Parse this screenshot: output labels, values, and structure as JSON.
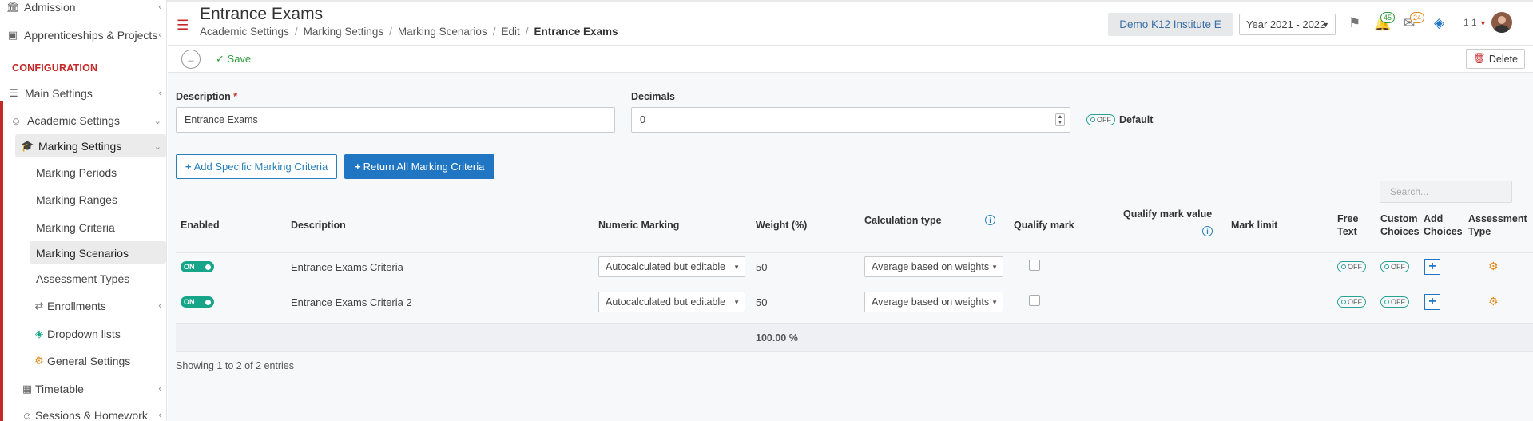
{
  "sidebar": {
    "items": [
      {
        "label": "Admission",
        "icon": "institution-icon"
      },
      {
        "label": "Apprenticeships & Projects",
        "icon": "cube-icon"
      },
      {
        "label": "Main Settings",
        "icon": "sliders-icon"
      },
      {
        "label": "Academic Settings",
        "icon": "users-icon"
      },
      {
        "label": "Marking Settings",
        "icon": "graduation-cap-icon"
      },
      {
        "label": "Marking Periods"
      },
      {
        "label": "Marking Ranges"
      },
      {
        "label": "Marking Criteria"
      },
      {
        "label": "Marking Scenarios"
      },
      {
        "label": "Assessment Types"
      },
      {
        "label": "Enrollments",
        "icon": "exchange-icon"
      },
      {
        "label": "Dropdown lists",
        "icon": "layers-icon"
      },
      {
        "label": "General Settings",
        "icon": "gears-icon"
      },
      {
        "label": "Timetable",
        "icon": "calendar-icon"
      },
      {
        "label": "Sessions & Homework",
        "icon": "users-icon"
      }
    ],
    "section_header": "CONFIGURATION"
  },
  "header": {
    "title": "Entrance Exams",
    "breadcrumb": [
      "Academic Settings",
      "Marking Settings",
      "Marking Scenarios",
      "Edit",
      "Entrance Exams"
    ],
    "institute": "Demo K12 Institute E",
    "year": "Year 2021 - 2022",
    "notifications_count": "45",
    "messages_count": "24",
    "user_label": "1 1"
  },
  "toolbar": {
    "save_label": "Save",
    "delete_label": "Delete"
  },
  "form": {
    "description_label": "Description",
    "description_required": "*",
    "description_value": "Entrance Exams",
    "decimals_label": "Decimals",
    "decimals_value": "0",
    "default_label": "Default",
    "default_toggle": "OFF"
  },
  "actions": {
    "add_specific": "Add Specific Marking Criteria",
    "return_all": "Return All Marking Criteria",
    "search_placeholder": "Search..."
  },
  "table": {
    "headers": {
      "enabled": "Enabled",
      "description": "Description",
      "numeric_marking": "Numeric Marking",
      "weight": "Weight (%)",
      "calculation_type": "Calculation type",
      "qualify_mark": "Qualify mark",
      "qualify_mark_value": "Qualify mark value",
      "mark_limit": "Mark limit",
      "free_text_1": "Free",
      "free_text_2": "Text",
      "custom_choices_1": "Custom",
      "custom_choices_2": "Choices",
      "add_choices_1": "Add",
      "add_choices_2": "Choices",
      "assessment_type_1": "Assessment",
      "assessment_type_2": "Type"
    },
    "rows": [
      {
        "enabled": "ON",
        "description": "Entrance Exams Criteria",
        "numeric_marking": "Autocalculated but editable",
        "weight": "50",
        "calculation_type": "Average based on weights",
        "free_text": "OFF",
        "custom_choices": "OFF"
      },
      {
        "enabled": "ON",
        "description": "Entrance Exams Criteria 2",
        "numeric_marking": "Autocalculated but editable",
        "weight": "50",
        "calculation_type": "Average based on weights",
        "free_text": "OFF",
        "custom_choices": "OFF"
      }
    ],
    "total_weight": "100.00 %",
    "footer": "Showing 1 to 2 of 2 entries"
  },
  "colors": {
    "accent_red": "#c62828",
    "primary_blue": "#2176c4",
    "toggle_teal": "#17a589",
    "save_green": "#2e9c3a"
  }
}
